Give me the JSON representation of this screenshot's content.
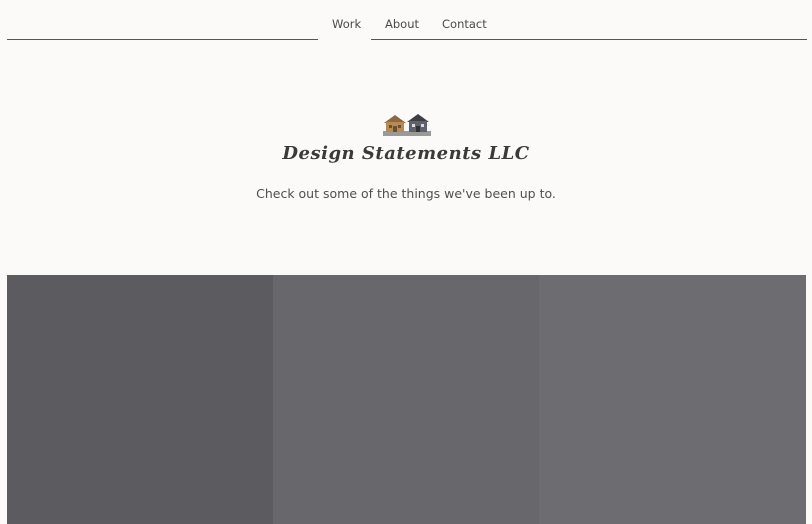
{
  "nav": {
    "items": [
      {
        "label": "Work"
      },
      {
        "label": "About"
      },
      {
        "label": "Contact"
      }
    ]
  },
  "hero": {
    "logo_icon": "houses-icon",
    "brand": "Design Statements LLC",
    "tagline": "Check out some of the things we've been up to."
  },
  "gallery": {
    "tile_colors": [
      "#5c5b60",
      "#68676c",
      "#6d6c71"
    ]
  },
  "colors": {
    "background": "#fbfaf8",
    "text": "#4a4a4a",
    "nav_line": "#555555"
  }
}
